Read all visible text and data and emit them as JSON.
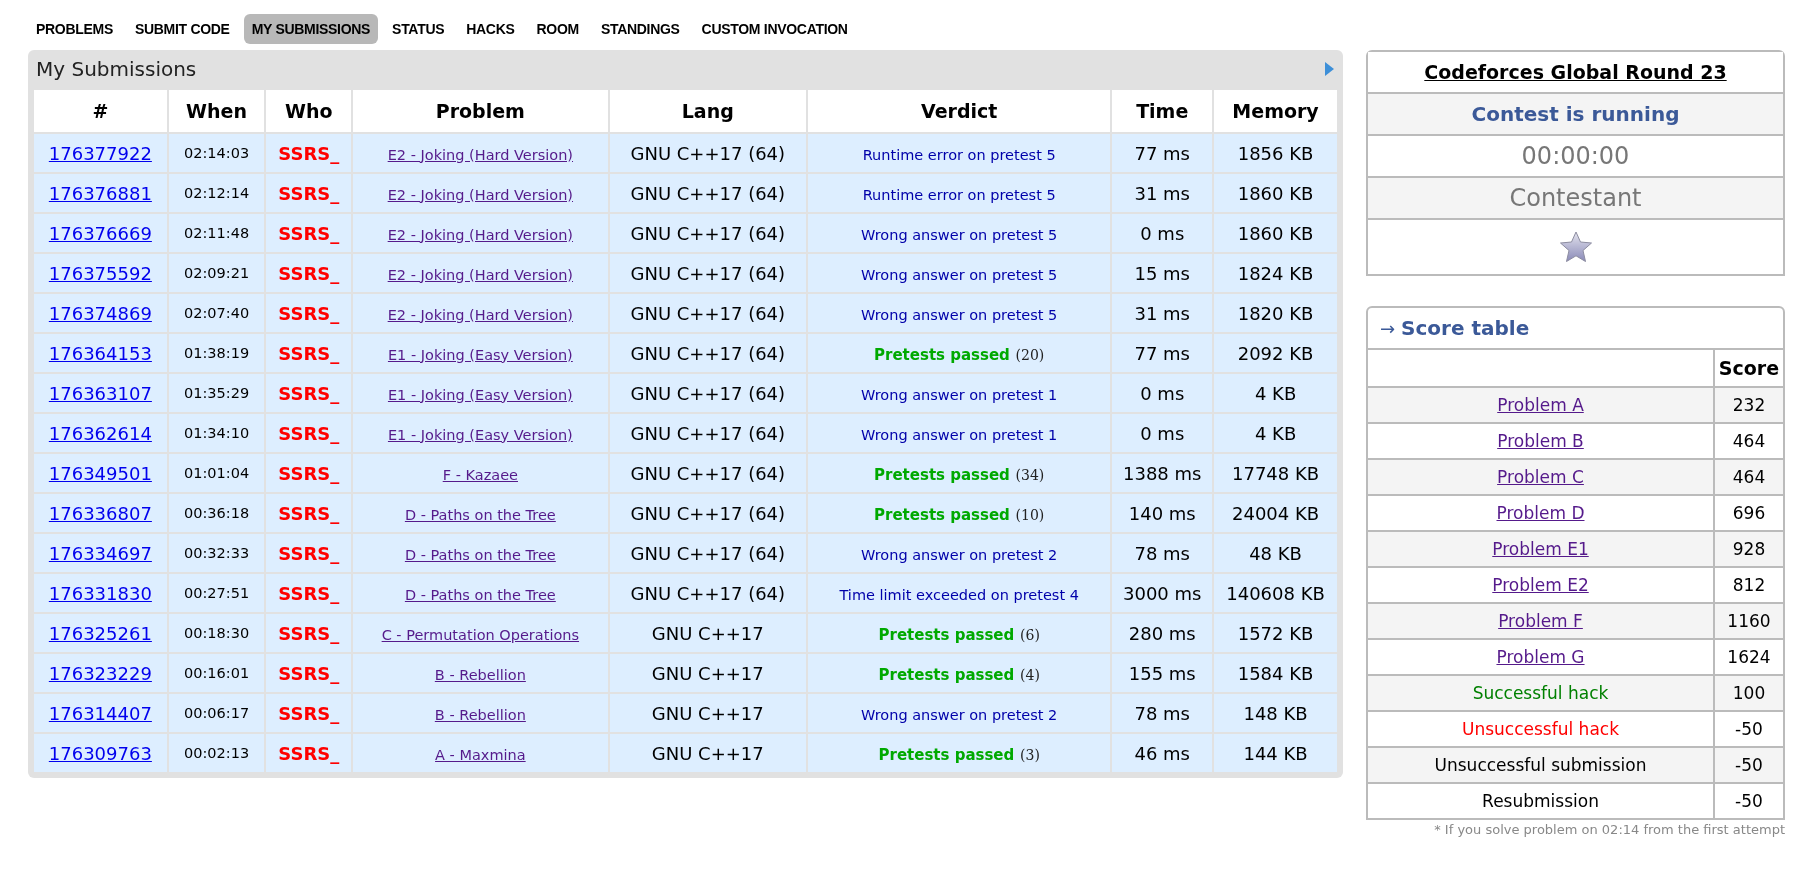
{
  "nav": [
    {
      "label": "PROBLEMS",
      "selected": false
    },
    {
      "label": "SUBMIT CODE",
      "selected": false
    },
    {
      "label": "MY SUBMISSIONS",
      "selected": true
    },
    {
      "label": "STATUS",
      "selected": false
    },
    {
      "label": "HACKS",
      "selected": false
    },
    {
      "label": "ROOM",
      "selected": false
    },
    {
      "label": "STANDINGS",
      "selected": false
    },
    {
      "label": "CUSTOM INVOCATION",
      "selected": false
    }
  ],
  "submissions": {
    "title": "My Submissions",
    "columns": [
      "#",
      "When",
      "Who",
      "Problem",
      "Lang",
      "Verdict",
      "Time",
      "Memory"
    ],
    "rows": [
      {
        "id": "176377922",
        "when": "02:14:03",
        "who": "SSRS_",
        "problem": "E2 - Joking (Hard Version)",
        "lang": "GNU C++17 (64)",
        "verdict": {
          "kind": "fail",
          "text": "Runtime error on pretest 5"
        },
        "time": "77 ms",
        "memory": "1856 KB"
      },
      {
        "id": "176376881",
        "when": "02:12:14",
        "who": "SSRS_",
        "problem": "E2 - Joking (Hard Version)",
        "lang": "GNU C++17 (64)",
        "verdict": {
          "kind": "fail",
          "text": "Runtime error on pretest 5"
        },
        "time": "31 ms",
        "memory": "1860 KB"
      },
      {
        "id": "176376669",
        "when": "02:11:48",
        "who": "SSRS_",
        "problem": "E2 - Joking (Hard Version)",
        "lang": "GNU C++17 (64)",
        "verdict": {
          "kind": "fail",
          "text": "Wrong answer on pretest 5"
        },
        "time": "0 ms",
        "memory": "1860 KB"
      },
      {
        "id": "176375592",
        "when": "02:09:21",
        "who": "SSRS_",
        "problem": "E2 - Joking (Hard Version)",
        "lang": "GNU C++17 (64)",
        "verdict": {
          "kind": "fail",
          "text": "Wrong answer on pretest 5"
        },
        "time": "15 ms",
        "memory": "1824 KB"
      },
      {
        "id": "176374869",
        "when": "02:07:40",
        "who": "SSRS_",
        "problem": "E2 - Joking (Hard Version)",
        "lang": "GNU C++17 (64)",
        "verdict": {
          "kind": "fail",
          "text": "Wrong answer on pretest 5"
        },
        "time": "31 ms",
        "memory": "1820 KB"
      },
      {
        "id": "176364153",
        "when": "01:38:19",
        "who": "SSRS_",
        "problem": "E1 - Joking (Easy Version)",
        "lang": "GNU C++17 (64)",
        "verdict": {
          "kind": "passed",
          "text": "Pretests passed",
          "count": "(20)"
        },
        "time": "77 ms",
        "memory": "2092 KB"
      },
      {
        "id": "176363107",
        "when": "01:35:29",
        "who": "SSRS_",
        "problem": "E1 - Joking (Easy Version)",
        "lang": "GNU C++17 (64)",
        "verdict": {
          "kind": "fail",
          "text": "Wrong answer on pretest 1"
        },
        "time": "0 ms",
        "memory": "4 KB"
      },
      {
        "id": "176362614",
        "when": "01:34:10",
        "who": "SSRS_",
        "problem": "E1 - Joking (Easy Version)",
        "lang": "GNU C++17 (64)",
        "verdict": {
          "kind": "fail",
          "text": "Wrong answer on pretest 1"
        },
        "time": "0 ms",
        "memory": "4 KB"
      },
      {
        "id": "176349501",
        "when": "01:01:04",
        "who": "SSRS_",
        "problem": "F - Kazaee",
        "lang": "GNU C++17 (64)",
        "verdict": {
          "kind": "passed",
          "text": "Pretests passed",
          "count": "(34)"
        },
        "time": "1388 ms",
        "memory": "17748 KB"
      },
      {
        "id": "176336807",
        "when": "00:36:18",
        "who": "SSRS_",
        "problem": "D - Paths on the Tree",
        "lang": "GNU C++17 (64)",
        "verdict": {
          "kind": "passed",
          "text": "Pretests passed",
          "count": "(10)"
        },
        "time": "140 ms",
        "memory": "24004 KB"
      },
      {
        "id": "176334697",
        "when": "00:32:33",
        "who": "SSRS_",
        "problem": "D - Paths on the Tree",
        "lang": "GNU C++17 (64)",
        "verdict": {
          "kind": "fail",
          "text": "Wrong answer on pretest 2"
        },
        "time": "78 ms",
        "memory": "48 KB"
      },
      {
        "id": "176331830",
        "when": "00:27:51",
        "who": "SSRS_",
        "problem": "D - Paths on the Tree",
        "lang": "GNU C++17 (64)",
        "verdict": {
          "kind": "fail",
          "text": "Time limit exceeded on pretest 4"
        },
        "time": "3000 ms",
        "memory": "140608 KB"
      },
      {
        "id": "176325261",
        "when": "00:18:30",
        "who": "SSRS_",
        "problem": "C - Permutation Operations",
        "lang": "GNU C++17",
        "verdict": {
          "kind": "passed",
          "text": "Pretests passed",
          "count": "(6)"
        },
        "time": "280 ms",
        "memory": "1572 KB"
      },
      {
        "id": "176323229",
        "when": "00:16:01",
        "who": "SSRS_",
        "problem": "B - Rebellion",
        "lang": "GNU C++17",
        "verdict": {
          "kind": "passed",
          "text": "Pretests passed",
          "count": "(4)"
        },
        "time": "155 ms",
        "memory": "1584 KB"
      },
      {
        "id": "176314407",
        "when": "00:06:17",
        "who": "SSRS_",
        "problem": "B - Rebellion",
        "lang": "GNU C++17",
        "verdict": {
          "kind": "fail",
          "text": "Wrong answer on pretest 2"
        },
        "time": "78 ms",
        "memory": "148 KB"
      },
      {
        "id": "176309763",
        "when": "00:02:13",
        "who": "SSRS_",
        "problem": "A - Maxmina",
        "lang": "GNU C++17",
        "verdict": {
          "kind": "passed",
          "text": "Pretests passed",
          "count": "(3)"
        },
        "time": "46 ms",
        "memory": "144 KB"
      }
    ]
  },
  "contest": {
    "name": "Codeforces Global Round 23",
    "status": "Contest is running",
    "timer": "00:00:00",
    "role": "Contestant"
  },
  "score_table": {
    "arrow": "→",
    "title": "Score table",
    "score_header": "Score",
    "rows": [
      {
        "kind": "problem",
        "label": "Problem A",
        "score": "232"
      },
      {
        "kind": "problem",
        "label": "Problem B",
        "score": "464"
      },
      {
        "kind": "problem",
        "label": "Problem C",
        "score": "464"
      },
      {
        "kind": "problem",
        "label": "Problem D",
        "score": "696"
      },
      {
        "kind": "problem",
        "label": "Problem E1",
        "score": "928"
      },
      {
        "kind": "problem",
        "label": "Problem E2",
        "score": "812"
      },
      {
        "kind": "problem",
        "label": "Problem F",
        "score": "1160"
      },
      {
        "kind": "problem",
        "label": "Problem G",
        "score": "1624"
      },
      {
        "kind": "success",
        "label": "Successful hack",
        "score": "100"
      },
      {
        "kind": "failure",
        "label": "Unsuccessful hack",
        "score": "-50"
      },
      {
        "kind": "plain",
        "label": "Unsuccessful submission",
        "score": "-50"
      },
      {
        "kind": "plain",
        "label": "Resubmission",
        "score": "-50"
      }
    ],
    "note": "* If you solve problem on 02:14 from the first attempt"
  }
}
